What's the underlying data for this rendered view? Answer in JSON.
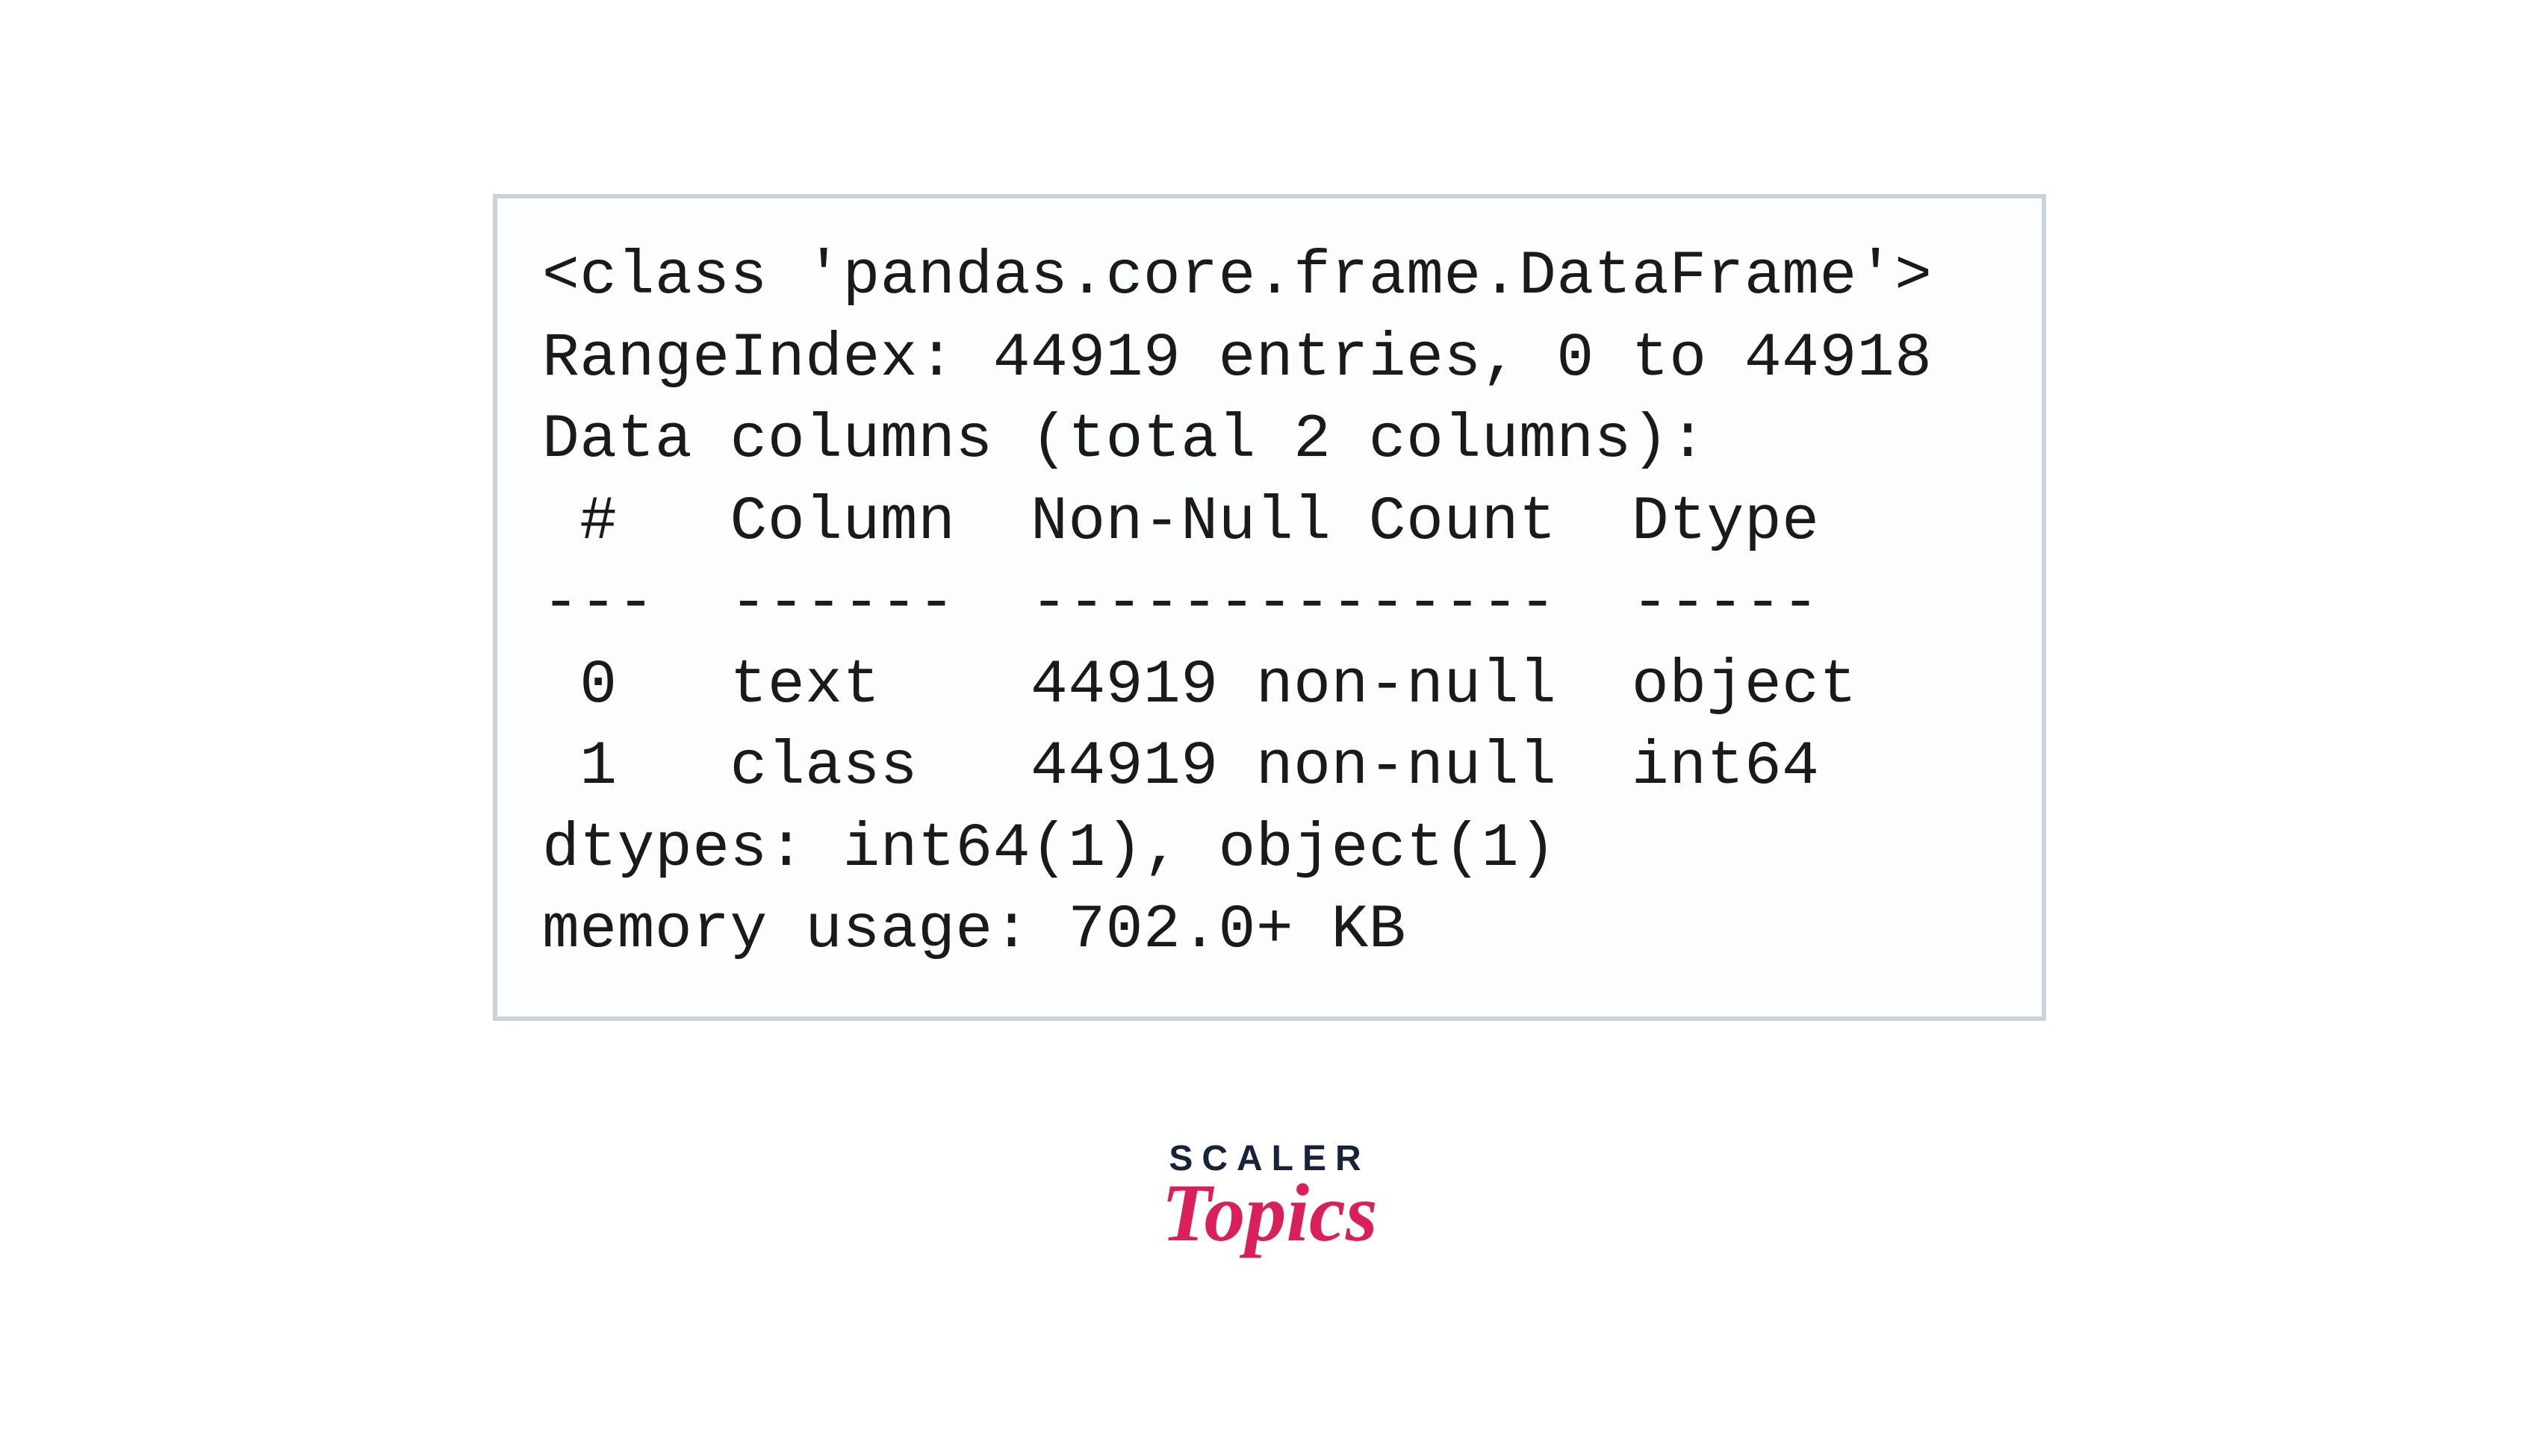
{
  "output": {
    "class_line": "<class 'pandas.core.frame.DataFrame'>",
    "range_index": "RangeIndex: 44919 entries, 0 to 44918",
    "data_columns": "Data columns (total 2 columns):",
    "header_row": " #   Column  Non-Null Count  Dtype ",
    "divider_row": "---  ------  --------------  ----- ",
    "row0": " 0   text    44919 non-null  object",
    "row1": " 1   class   44919 non-null  int64 ",
    "dtypes": "dtypes: int64(1), object(1)",
    "memory": "memory usage: 702.0+ KB"
  },
  "logo": {
    "top": "SCALER",
    "bottom": "Topics"
  }
}
